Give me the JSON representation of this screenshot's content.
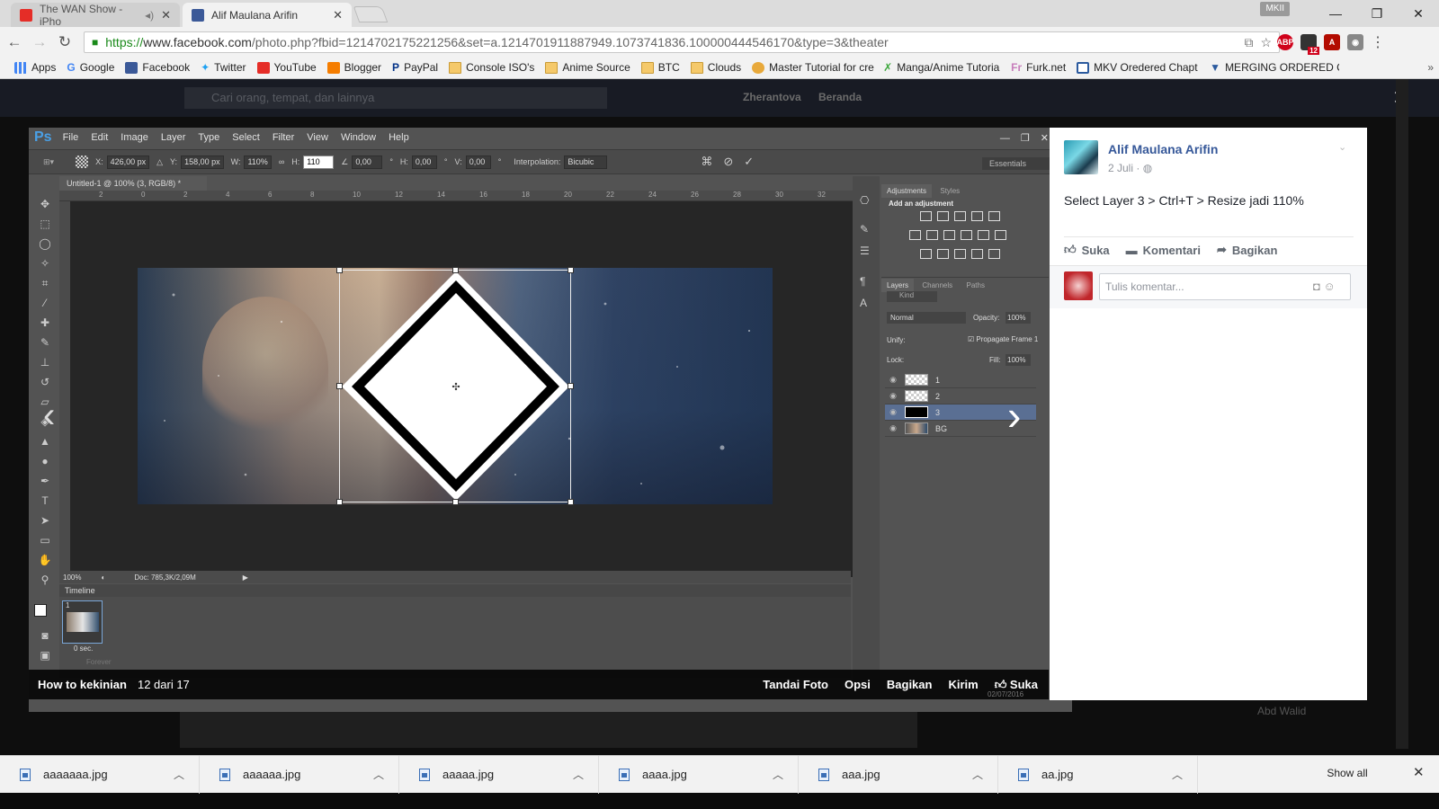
{
  "browser": {
    "tabs": [
      {
        "title": "The WAN Show - iPho",
        "favicon_color": "#e52d27",
        "active": false
      },
      {
        "title": "Alif Maulana Arifin",
        "favicon_color": "#3b5998",
        "active": true
      }
    ],
    "profile_badge": "MKII",
    "url": {
      "scheme": "https://",
      "host": "www.facebook.com",
      "path": "/photo.php?fbid=1214702175221256&set=a.1214701911887949.1073741836.100000444546170&type=3&theater"
    },
    "bookmarks": [
      "Apps",
      "Google",
      "Facebook",
      "Twitter",
      "YouTube",
      "Blogger",
      "PayPal",
      "Console ISO's",
      "Anime Source",
      "BTC",
      "Clouds",
      "Master Tutorial for cre",
      "Manga/Anime Tutoria",
      "Furk.net",
      "MKV Oredered Chapt",
      "MERGING ORDERED C"
    ],
    "ext_badge": "12"
  },
  "facebook_header": {
    "search_placeholder": "Cari orang, tempat, dan lainnya",
    "user": "Zherantova",
    "home": "Beranda"
  },
  "photoshop": {
    "logo": "Ps",
    "menu": [
      "File",
      "Edit",
      "Image",
      "Layer",
      "Type",
      "Select",
      "Filter",
      "View",
      "Window",
      "Help"
    ],
    "options": {
      "x_label": "X:",
      "x": "426,00 px",
      "y_label": "Y:",
      "y": "158,00 px",
      "w_label": "W:",
      "w": "110%",
      "h_label": "H:",
      "h": "110",
      "angle": "0,00",
      "hskew_label": "H:",
      "hskew": "0,00",
      "vskew_label": "V:",
      "vskew": "0,00",
      "interp_label": "Interpolation:",
      "interp": "Bicubic"
    },
    "workspace": "Essentials",
    "doc_tab": "Untitled-1 @ 100% (3, RGB/8) *",
    "ruler_top": [
      "2",
      "0",
      "2",
      "4",
      "6",
      "8",
      "10",
      "12",
      "14",
      "16",
      "18",
      "20",
      "22",
      "24",
      "26",
      "28",
      "30",
      "32"
    ],
    "zoom": "100%",
    "doc_info": "Doc: 785,3K/2,09M",
    "timeline_title": "Timeline",
    "frame_num": "1",
    "frame_delay": "0 sec.",
    "loop": "Forever",
    "adjustments": {
      "tab1": "Adjustments",
      "tab2": "Styles",
      "heading": "Add an adjustment"
    },
    "layers_panel": {
      "tabs": [
        "Layers",
        "Channels",
        "Paths"
      ],
      "kind": "Kind",
      "blend": "Normal",
      "opacity_label": "Opacity:",
      "opacity": "100%",
      "unify": "Unify:",
      "propagate": "Propagate Frame 1",
      "lock": "Lock:",
      "fill_label": "Fill:",
      "fill": "100%",
      "layers": [
        {
          "name": "1",
          "selected": false
        },
        {
          "name": "2",
          "selected": false
        },
        {
          "name": "3",
          "selected": true
        },
        {
          "name": "BG",
          "selected": false
        }
      ]
    }
  },
  "theater": {
    "album": "How to kekinian",
    "count": "12 dari 17",
    "actions": [
      "Tandai Foto",
      "Opsi",
      "Bagikan",
      "Kirim",
      "Suka"
    ],
    "timestamp": "02/07/2016"
  },
  "post": {
    "author": "Alif Maulana Arifin",
    "date": "2 Juli",
    "privacy_icon": "globe-icon",
    "text": "Select Layer 3 > Ctrl+T > Resize jadi 110%",
    "actions": [
      "Suka",
      "Komentari",
      "Bagikan"
    ],
    "comment_placeholder": "Tulis komentar..."
  },
  "chat_ghost": {
    "name": "Abd Walid"
  },
  "downloads": [
    "aaaaaaa.jpg",
    "aaaaaa.jpg",
    "aaaaa.jpg",
    "aaaa.jpg",
    "aaa.jpg",
    "aa.jpg"
  ],
  "show_all": "Show all"
}
